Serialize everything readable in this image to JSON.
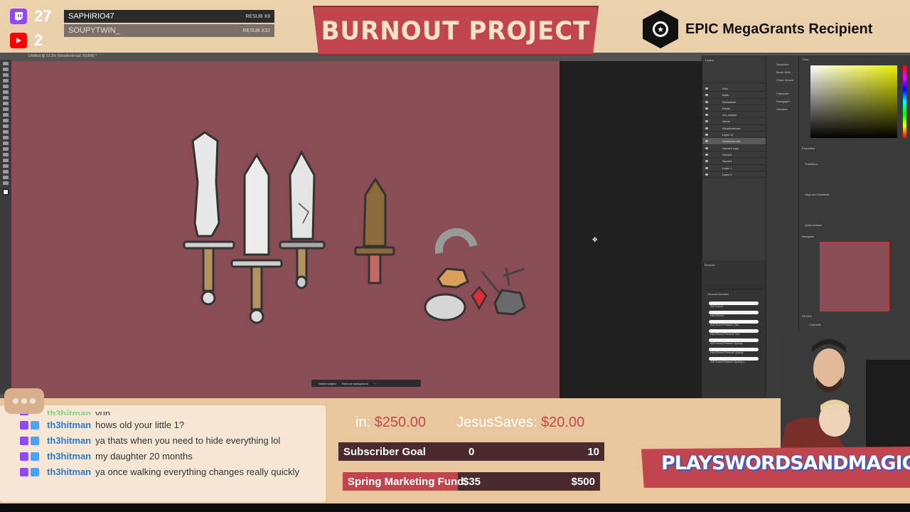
{
  "overlay": {
    "twitch_count": "27",
    "youtube_count": "2",
    "recent_subs": [
      {
        "name": "SAPHIRIO47",
        "tag": "RESUB X8"
      },
      {
        "name": "SOUPYTWIN_",
        "tag": "RESUB X32"
      }
    ],
    "banner_title": "BURNOUT PROJECT",
    "epic_label": "EPIC MegaGrants Recipient",
    "url_banner": "PLAYSWORDSANDMAGIC.COM"
  },
  "photoshop": {
    "doc_title": "Untitled @ 33.3% (Woodenbroad, RGB/8) *",
    "context_bar": [
      "Select subject",
      "Remove background"
    ],
    "layers": [
      "Grid",
      "Rails",
      "Horseshoe",
      "Rocks",
      "ore_copper",
      "Gems",
      "Woodenbroad",
      "Layer 11",
      "Woodenbroad",
      "Sword1 copy",
      "Sword1",
      "Sword1",
      "Layer 1",
      "Layer 2"
    ],
    "dock_items": [
      "Swatches",
      "Brush Setti...",
      "Clone Source",
      "Character",
      "Paragraph",
      "Libraries"
    ],
    "brushes_title": "Brushes",
    "brush_group": "General Brushes",
    "brush_names": [
      "Soft Round",
      "Hard Round",
      "Soft Round Pressure Size",
      "Hard Round Pressure Size",
      "Soft Round Pressure Opacity",
      "Hard Round Pressure Opacity",
      "Soft Round Pressure Opacity a..."
    ],
    "panels": {
      "color": "Color",
      "properties": "Properties",
      "transform": "Transform",
      "align": "Align and Distribute",
      "quick_actions": "Quick Actions",
      "navigator": "Navigator",
      "channels": "Channels",
      "zoom": "33.33%"
    }
  },
  "chat": {
    "partial_top": {
      "user": "th3hitman",
      "text": "yup"
    },
    "messages": [
      {
        "user": "th3hitman",
        "text": "hows old your little 1?"
      },
      {
        "user": "th3hitman",
        "text": "ya thats when you need to hide everything lol"
      },
      {
        "user": "th3hitman",
        "text": "my daughter 20 months"
      },
      {
        "user": "th3hitman",
        "text": "ya once walking everything changes really quickly"
      }
    ]
  },
  "ticker": {
    "items": [
      {
        "name": "in:",
        "amount": "$250.00"
      },
      {
        "name": "JesusSaves:",
        "amount": "$20.00"
      }
    ]
  },
  "goals": [
    {
      "label": "Subscriber Goal",
      "current": "0",
      "target": "10",
      "progress": 0
    },
    {
      "label": "Spring Marketing Fund",
      "current": "$35",
      "target": "$500",
      "progress": 0.07
    }
  ],
  "colors": {
    "canvas": "#8a4d55",
    "banner": "#c0454c",
    "frame": "#e8c79f",
    "chat_user": "#2a7bd5",
    "ticker_amount": "#c24a4a"
  }
}
